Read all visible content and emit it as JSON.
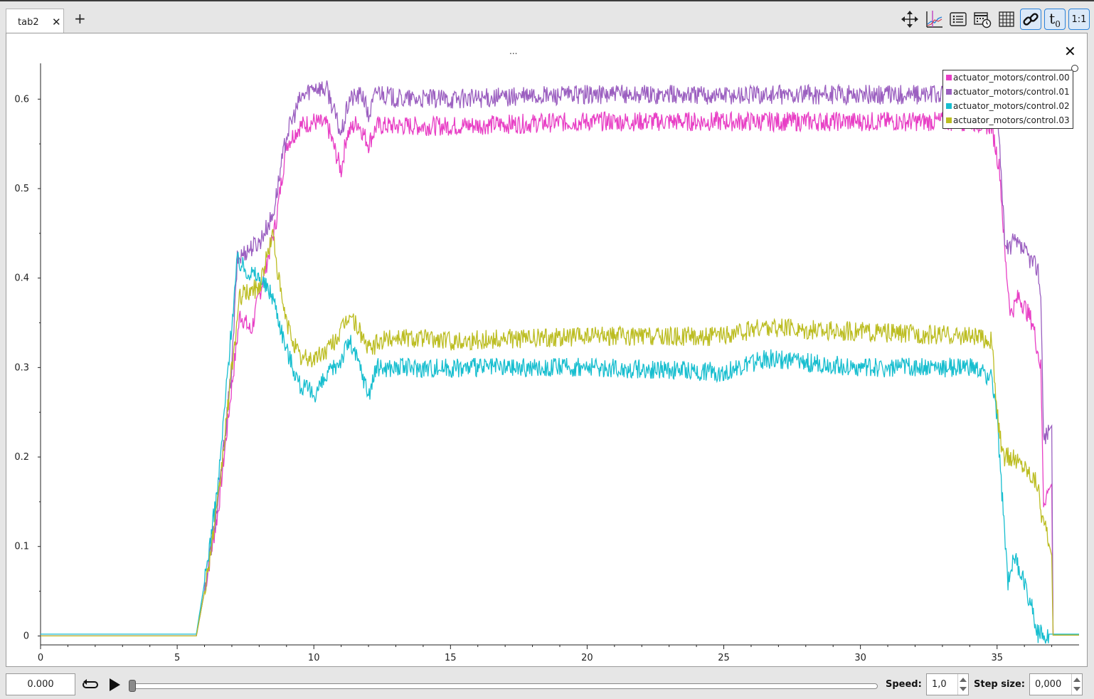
{
  "tabs": [
    {
      "label": "tab2",
      "close": "✕"
    }
  ],
  "add_tab": "+",
  "toolbar": {
    "items": [
      {
        "icon": "move-arrows-icon"
      },
      {
        "icon": "xy-plot-icon"
      },
      {
        "icon": "list-icon"
      },
      {
        "icon": "calendar-clock-icon"
      },
      {
        "icon": "grid-icon"
      },
      {
        "icon": "link-icon",
        "active": true
      },
      {
        "icon": "t0-icon",
        "label": "t",
        "sub": "0",
        "active": true
      },
      {
        "icon": "ratio-icon",
        "label": "1:1",
        "active": true
      }
    ]
  },
  "plot": {
    "title": "...",
    "close": "✕"
  },
  "chart_data": {
    "type": "line",
    "xlim": [
      0,
      38
    ],
    "ylim": [
      -0.01,
      0.64
    ],
    "xticks": [
      "0",
      "5",
      "10",
      "15",
      "20",
      "25",
      "30",
      "35"
    ],
    "yticks": [
      "0",
      "0.1",
      "0.2",
      "0.3",
      "0.4",
      "0.5",
      "0.6"
    ],
    "legend_position": "top-right",
    "series": [
      {
        "name": "actuator_motors/control.00",
        "color": "#e83fc5",
        "points": [
          [
            0,
            0
          ],
          [
            5.6,
            0
          ],
          [
            5.7,
            0
          ],
          [
            6,
            0.05
          ],
          [
            6.5,
            0.14
          ],
          [
            7,
            0.28
          ],
          [
            7.3,
            0.36
          ],
          [
            7.7,
            0.34
          ],
          [
            8,
            0.38
          ],
          [
            8.3,
            0.42
          ],
          [
            8.6,
            0.46
          ],
          [
            9,
            0.55
          ],
          [
            9.5,
            0.57
          ],
          [
            10,
            0.575
          ],
          [
            10.5,
            0.57
          ],
          [
            11,
            0.52
          ],
          [
            11.2,
            0.56
          ],
          [
            11.6,
            0.575
          ],
          [
            12,
            0.55
          ],
          [
            12.3,
            0.57
          ],
          [
            13,
            0.57
          ],
          [
            15,
            0.57
          ],
          [
            20,
            0.575
          ],
          [
            25,
            0.575
          ],
          [
            30,
            0.575
          ],
          [
            34,
            0.575
          ],
          [
            34.8,
            0.57
          ],
          [
            35.1,
            0.52
          ],
          [
            35.3,
            0.42
          ],
          [
            35.5,
            0.36
          ],
          [
            35.8,
            0.38
          ],
          [
            36.3,
            0.35
          ],
          [
            36.6,
            0.3
          ],
          [
            36.7,
            0.15
          ],
          [
            37,
            0.17
          ],
          [
            37.05,
            0.001
          ],
          [
            38,
            0.001
          ]
        ]
      },
      {
        "name": "actuator_motors/control.01",
        "color": "#9b5fc0",
        "points": [
          [
            0,
            0
          ],
          [
            5.6,
            0
          ],
          [
            5.7,
            0
          ],
          [
            6,
            0.05
          ],
          [
            6.5,
            0.15
          ],
          [
            7,
            0.3
          ],
          [
            7.2,
            0.42
          ],
          [
            7.5,
            0.43
          ],
          [
            8,
            0.44
          ],
          [
            8.5,
            0.47
          ],
          [
            9,
            0.56
          ],
          [
            9.5,
            0.6
          ],
          [
            10,
            0.615
          ],
          [
            10.5,
            0.61
          ],
          [
            11,
            0.56
          ],
          [
            11.3,
            0.6
          ],
          [
            11.8,
            0.605
          ],
          [
            12,
            0.58
          ],
          [
            12.3,
            0.61
          ],
          [
            13,
            0.6
          ],
          [
            15,
            0.6
          ],
          [
            20,
            0.605
          ],
          [
            25,
            0.605
          ],
          [
            30,
            0.605
          ],
          [
            34,
            0.605
          ],
          [
            34.9,
            0.6
          ],
          [
            35.1,
            0.55
          ],
          [
            35.3,
            0.43
          ],
          [
            35.6,
            0.44
          ],
          [
            36,
            0.43
          ],
          [
            36.5,
            0.41
          ],
          [
            36.6,
            0.38
          ],
          [
            36.7,
            0.22
          ],
          [
            37,
            0.235
          ],
          [
            37.05,
            0.001
          ],
          [
            38,
            0.001
          ]
        ]
      },
      {
        "name": "actuator_motors/control.02",
        "color": "#17becf",
        "points": [
          [
            0,
            0.002
          ],
          [
            5.6,
            0.002
          ],
          [
            5.7,
            0.002
          ],
          [
            6,
            0.06
          ],
          [
            6.5,
            0.17
          ],
          [
            7,
            0.35
          ],
          [
            7.2,
            0.42
          ],
          [
            7.5,
            0.41
          ],
          [
            8,
            0.4
          ],
          [
            8.5,
            0.38
          ],
          [
            9,
            0.32
          ],
          [
            9.5,
            0.28
          ],
          [
            10,
            0.27
          ],
          [
            10.5,
            0.29
          ],
          [
            11,
            0.31
          ],
          [
            11.3,
            0.33
          ],
          [
            11.7,
            0.3
          ],
          [
            12,
            0.27
          ],
          [
            12.3,
            0.3
          ],
          [
            13,
            0.3
          ],
          [
            15,
            0.3
          ],
          [
            20,
            0.3
          ],
          [
            25,
            0.295
          ],
          [
            26.5,
            0.31
          ],
          [
            30,
            0.3
          ],
          [
            34,
            0.3
          ],
          [
            34.8,
            0.29
          ],
          [
            35,
            0.24
          ],
          [
            35.2,
            0.15
          ],
          [
            35.4,
            0.06
          ],
          [
            35.6,
            0.09
          ],
          [
            36,
            0.06
          ],
          [
            36.3,
            0.03
          ],
          [
            36.5,
            0.002
          ],
          [
            37,
            0.002
          ],
          [
            38,
            0.002
          ]
        ]
      },
      {
        "name": "actuator_motors/control.03",
        "color": "#bcbd22",
        "points": [
          [
            0,
            0
          ],
          [
            5.6,
            0
          ],
          [
            5.7,
            0
          ],
          [
            6,
            0.05
          ],
          [
            6.5,
            0.15
          ],
          [
            7,
            0.3
          ],
          [
            7.3,
            0.38
          ],
          [
            8,
            0.39
          ],
          [
            8.5,
            0.45
          ],
          [
            8.8,
            0.38
          ],
          [
            9,
            0.35
          ],
          [
            9.5,
            0.31
          ],
          [
            10,
            0.31
          ],
          [
            10.5,
            0.32
          ],
          [
            11,
            0.34
          ],
          [
            11.3,
            0.36
          ],
          [
            11.7,
            0.34
          ],
          [
            12,
            0.32
          ],
          [
            12.5,
            0.33
          ],
          [
            13,
            0.335
          ],
          [
            15,
            0.33
          ],
          [
            20,
            0.335
          ],
          [
            25,
            0.335
          ],
          [
            26.5,
            0.345
          ],
          [
            30,
            0.34
          ],
          [
            34,
            0.335
          ],
          [
            34.8,
            0.33
          ],
          [
            35,
            0.25
          ],
          [
            35.2,
            0.2
          ],
          [
            35.5,
            0.2
          ],
          [
            36,
            0.19
          ],
          [
            36.5,
            0.17
          ],
          [
            36.6,
            0.14
          ],
          [
            37,
            0.09
          ],
          [
            37.05,
            0.001
          ],
          [
            38,
            0.001
          ]
        ]
      }
    ]
  },
  "playback": {
    "time_value": "0.000",
    "speed_label": "Speed:",
    "speed_value": "1,0",
    "step_label": "Step size:",
    "step_value": "0,000"
  }
}
